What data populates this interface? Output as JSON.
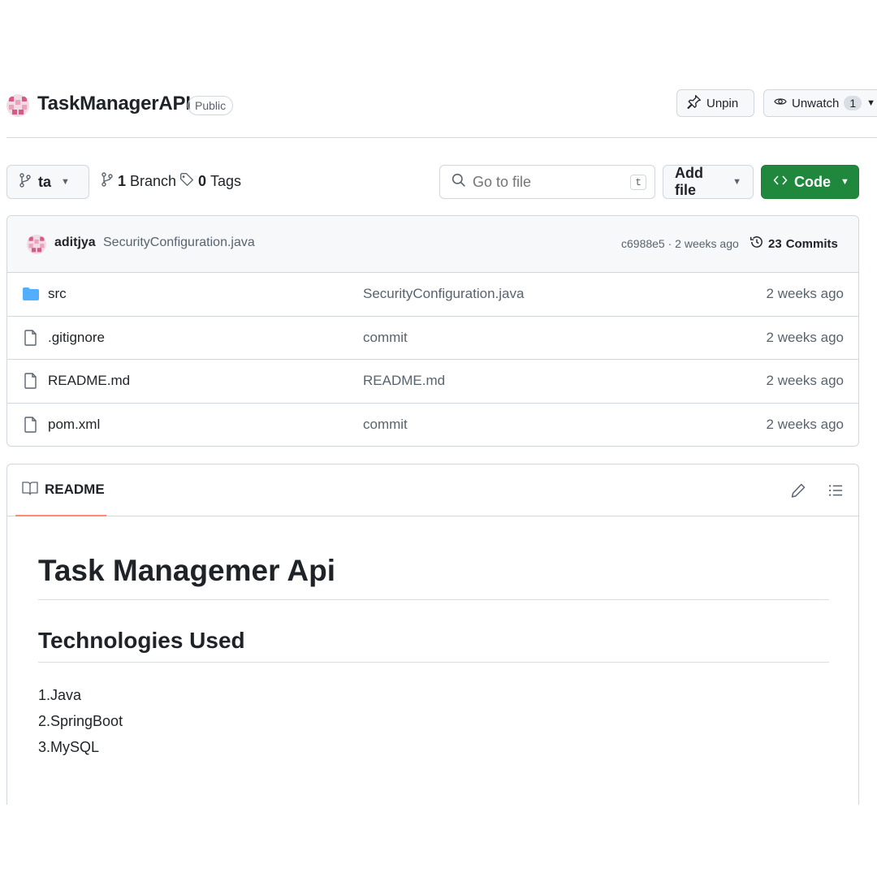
{
  "repo": {
    "name": "TaskManagerAPI",
    "visibility": "Public",
    "unpin_label": "Unpin",
    "unwatch_label": "Unwatch",
    "watch_count": "1"
  },
  "toolbar": {
    "branch": "ta",
    "branches_count": "1",
    "branches_label": "Branch",
    "tags_count": "0",
    "tags_label": "Tags",
    "search_placeholder": "Go to file",
    "search_shortcut": "t",
    "add_file_label": "Add file",
    "code_label": "Code"
  },
  "latest_commit": {
    "author": "aditjya",
    "message": "SecurityConfiguration.java",
    "meta": "c6988e5 · 2 weeks ago",
    "commits_count": "23",
    "commits_label": "Commits"
  },
  "files": [
    {
      "name": "src",
      "type": "folder",
      "commit": "SecurityConfiguration.java",
      "age": "2 weeks ago"
    },
    {
      "name": ".gitignore",
      "type": "file",
      "commit": "commit",
      "age": "2 weeks ago"
    },
    {
      "name": "README.md",
      "type": "file",
      "commit": "README.md",
      "age": "2 weeks ago"
    },
    {
      "name": "pom.xml",
      "type": "file",
      "commit": "commit",
      "age": "2 weeks ago"
    }
  ],
  "readme": {
    "tab_label": "README",
    "title": "Task Managemer Api",
    "subtitle": "Technologies Used",
    "items": [
      "1.Java",
      "2.SpringBoot",
      "3.MySQL"
    ]
  },
  "colors": {
    "accent_green": "#1f883d",
    "folder_blue": "#54aeff",
    "tab_underline": "#fd8c73"
  },
  "icons": {
    "avatar": "identicon-avatar",
    "pin": "pin-icon",
    "eye": "eye-icon",
    "branch": "git-branch-icon",
    "tag": "tag-icon",
    "search": "search-icon",
    "code": "code-icon",
    "history": "history-icon",
    "folder": "folder-icon",
    "file": "file-icon",
    "book": "book-icon",
    "pencil": "pencil-icon",
    "list": "list-unordered-icon"
  }
}
